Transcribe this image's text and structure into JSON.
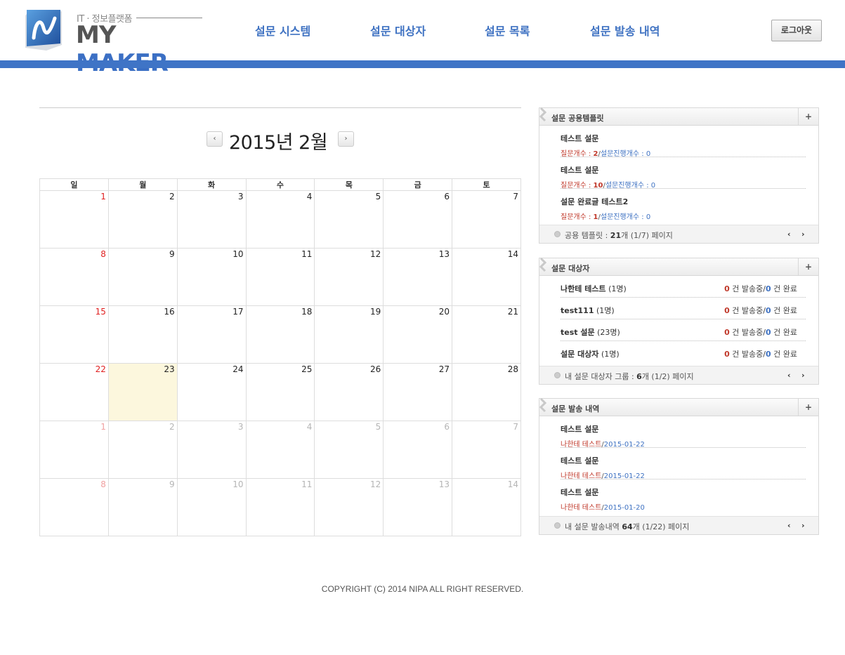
{
  "logo": {
    "subtitle": "IT · 정보플랫폼",
    "word_my": "MY",
    "word_maker": "MAKER"
  },
  "nav": [
    "설문 시스템",
    "설문 대상자",
    "설문 목록",
    "설문 발송 내역"
  ],
  "logout_label": "로그아웃",
  "calendar": {
    "title": "2015년 2월",
    "prev_label": "‹",
    "next_label": "›",
    "weekdays": [
      "일",
      "월",
      "화",
      "수",
      "목",
      "금",
      "토"
    ],
    "weeks": [
      [
        "1",
        "2",
        "3",
        "4",
        "5",
        "6",
        "7"
      ],
      [
        "8",
        "9",
        "10",
        "11",
        "12",
        "13",
        "14"
      ],
      [
        "15",
        "16",
        "17",
        "18",
        "19",
        "20",
        "21"
      ],
      [
        "22",
        "23",
        "24",
        "25",
        "26",
        "27",
        "28"
      ],
      [
        "1",
        "2",
        "3",
        "4",
        "5",
        "6",
        "7"
      ],
      [
        "8",
        "9",
        "10",
        "11",
        "12",
        "13",
        "14"
      ]
    ],
    "today": "23"
  },
  "templates_panel": {
    "title": "설문 공용템플릿",
    "plus": "+",
    "items": [
      {
        "title": "테스트 설문",
        "q_label": "질문개수 : ",
        "q_count": "2",
        "progress_label": "설문진행개수 : ",
        "progress_count": "0"
      },
      {
        "title": "테스트 설문",
        "q_label": "질문개수 : ",
        "q_count": "10",
        "progress_label": "설문진행개수 : ",
        "progress_count": "0"
      },
      {
        "title": "설문 완료글 테스트2",
        "q_label": "질문개수 : ",
        "q_count": "1",
        "progress_label": "설문진행개수 : ",
        "progress_count": "0"
      }
    ],
    "footer_prefix": "공용 템플릿 : ",
    "footer_count": "21",
    "footer_suffix": "개 (1/7) 페이지",
    "prev": "‹",
    "next": "›"
  },
  "targets_panel": {
    "title": "설문 대상자",
    "plus": "+",
    "items": [
      {
        "name": "나한테 테스트",
        "count": "(1명)",
        "sending": "0",
        "sending_label": " 건 발송중",
        "done": "0",
        "done_label": " 건 완료"
      },
      {
        "name": "test111",
        "count": "(1명)",
        "sending": "0",
        "sending_label": " 건 발송중",
        "done": "0",
        "done_label": " 건 완료"
      },
      {
        "name": "test 설문",
        "count": "(23명)",
        "sending": "0",
        "sending_label": " 건 발송중",
        "done": "0",
        "done_label": " 건 완료"
      },
      {
        "name": "설문 대상자",
        "count": "(1명)",
        "sending": "0",
        "sending_label": " 건 발송중",
        "done": "0",
        "done_label": " 건 완료"
      }
    ],
    "footer_prefix": "내 설문 대상자 그룹 : ",
    "footer_count": "6",
    "footer_suffix": "개 (1/2) 페이지",
    "prev": "‹",
    "next": "›"
  },
  "history_panel": {
    "title": "설문 발송 내역",
    "plus": "+",
    "items": [
      {
        "title": "테스트 설문",
        "group": "나한테 테스트",
        "date": "2015-01-22"
      },
      {
        "title": "테스트 설문",
        "group": "나한테 테스트",
        "date": "2015-01-22"
      },
      {
        "title": "테스트 설문",
        "group": "나한테 테스트",
        "date": "2015-01-20"
      }
    ],
    "footer_prefix": "내 설문 발송내역 ",
    "footer_count": "64",
    "footer_suffix": "개 (1/22) 페이지",
    "prev": "‹",
    "next": "›"
  },
  "footer": "COPYRIGHT (C) 2014 NIPA ALL RIGHT RESERVED."
}
